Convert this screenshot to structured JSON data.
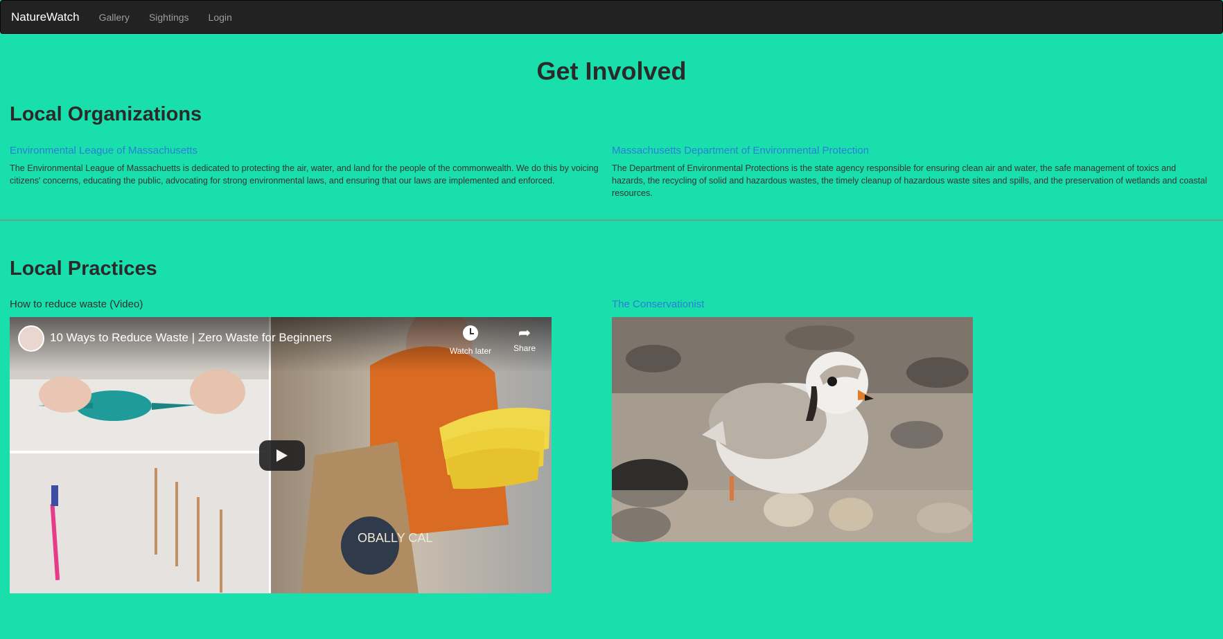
{
  "navbar": {
    "brand": "NatureWatch",
    "links": [
      "Gallery",
      "Sightings",
      "Login"
    ]
  },
  "page_title": "Get Involved",
  "organizations": {
    "heading": "Local Organizations",
    "items": [
      {
        "title": "Environmental League of Massachusetts",
        "description": "The Environmental League of Massachuetts is dedicated to protecting the air, water, and land for the people of the commonwealth. We do this by voicing citizens' concerns, educating the public, advocating for strong environmental laws, and ensuring that our laws are implemented and enforced."
      },
      {
        "title": "Massachusetts Department of Environmental Protection",
        "description": "The Department of Environmental Protections is the state agency responsible for ensuring clean air and water, the safe management of toxics and hazards, the recycling of solid and hazardous wastes, the timely cleanup of hazardous waste sites and spills, and the preservation of wetlands and coastal resources."
      }
    ]
  },
  "practices": {
    "heading": "Local Practices",
    "video_label": "How to reduce waste (Video)",
    "video": {
      "title": "10 Ways to Reduce Waste | Zero Waste for Beginners",
      "watch_later": "Watch later",
      "share": "Share",
      "bag_text": "OBALLY CAL"
    },
    "article_link": "The Conservationist"
  },
  "colors": {
    "page_background": "#19dfac",
    "navbar_background": "#222222",
    "link": "#2a7fd6"
  },
  "icons": {
    "play": "play-icon",
    "clock": "clock-icon",
    "share": "share-icon"
  }
}
